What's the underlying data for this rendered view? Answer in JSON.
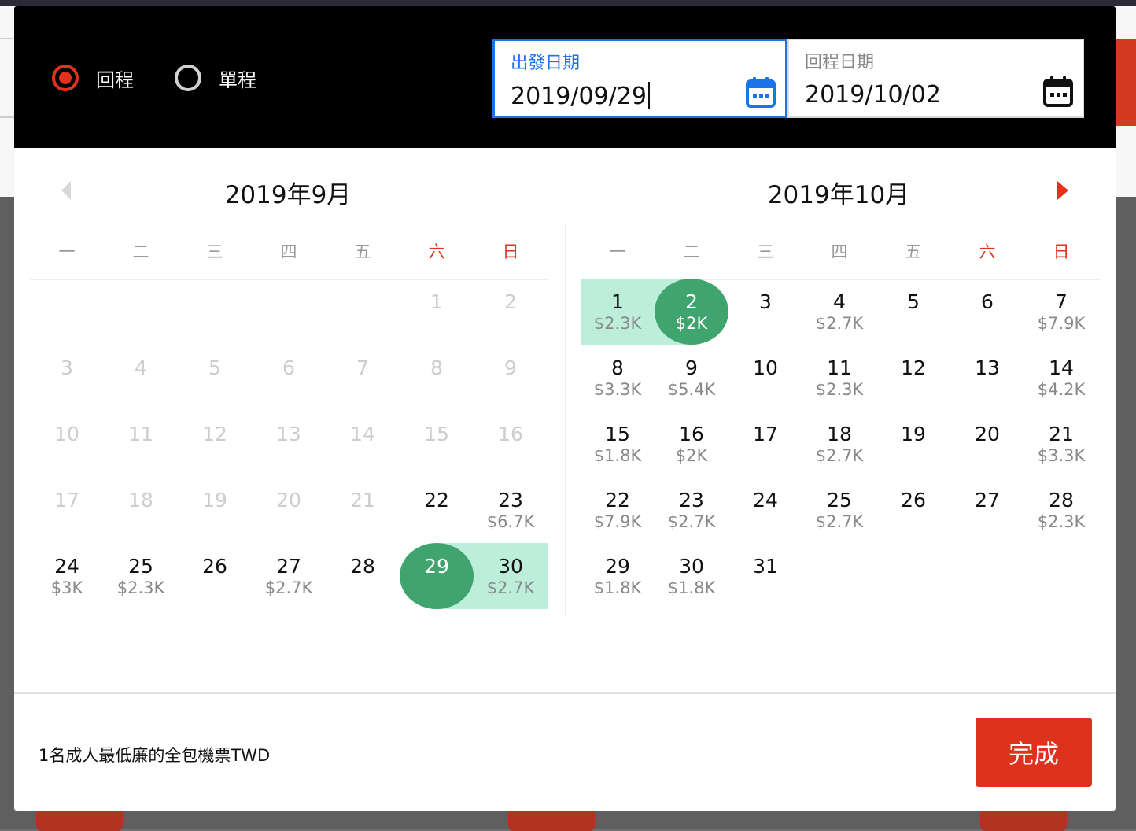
{
  "trip_type": {
    "options": [
      {
        "label": "回程",
        "checked": true
      },
      {
        "label": "單程",
        "checked": false
      }
    ]
  },
  "departure": {
    "label": "出發日期",
    "value": "2019/09/29",
    "icon": "calendar-icon",
    "active": true
  },
  "return": {
    "label": "回程日期",
    "value": "2019/10/02",
    "icon": "calendar-icon",
    "active": false
  },
  "colors": {
    "accent": "#e0321d",
    "focus": "#1a73e8",
    "selected": "#3fa46e",
    "range": "#bdeedb"
  },
  "weekdays": [
    "一",
    "二",
    "三",
    "四",
    "五",
    "六",
    "日"
  ],
  "months": [
    {
      "title": "2019年9月",
      "first_weekday": 6,
      "days": [
        {
          "d": "1",
          "p": "",
          "dis": true
        },
        {
          "d": "2",
          "p": "",
          "dis": true
        },
        {
          "d": "3",
          "p": "",
          "dis": true
        },
        {
          "d": "4",
          "p": "",
          "dis": true
        },
        {
          "d": "5",
          "p": "",
          "dis": true
        },
        {
          "d": "6",
          "p": "",
          "dis": true
        },
        {
          "d": "7",
          "p": "",
          "dis": true
        },
        {
          "d": "8",
          "p": "",
          "dis": true
        },
        {
          "d": "9",
          "p": "",
          "dis": true
        },
        {
          "d": "10",
          "p": "",
          "dis": true
        },
        {
          "d": "11",
          "p": "",
          "dis": true
        },
        {
          "d": "12",
          "p": "",
          "dis": true
        },
        {
          "d": "13",
          "p": "",
          "dis": true
        },
        {
          "d": "14",
          "p": "",
          "dis": true
        },
        {
          "d": "15",
          "p": "",
          "dis": true
        },
        {
          "d": "16",
          "p": "",
          "dis": true
        },
        {
          "d": "17",
          "p": "",
          "dis": true
        },
        {
          "d": "18",
          "p": "",
          "dis": true
        },
        {
          "d": "19",
          "p": "",
          "dis": true
        },
        {
          "d": "20",
          "p": "",
          "dis": true
        },
        {
          "d": "21",
          "p": "",
          "dis": true
        },
        {
          "d": "22",
          "p": ""
        },
        {
          "d": "23",
          "p": "$6.7K"
        },
        {
          "d": "24",
          "p": "$3K"
        },
        {
          "d": "25",
          "p": "$2.3K"
        },
        {
          "d": "26",
          "p": ""
        },
        {
          "d": "27",
          "p": "$2.7K"
        },
        {
          "d": "28",
          "p": ""
        },
        {
          "d": "29",
          "p": "",
          "sel": "start"
        },
        {
          "d": "30",
          "p": "$2.7K",
          "range": true
        }
      ]
    },
    {
      "title": "2019年10月",
      "first_weekday": 1,
      "days": [
        {
          "d": "1",
          "p": "$2.3K",
          "range": true
        },
        {
          "d": "2",
          "p": "$2K",
          "sel": "end"
        },
        {
          "d": "3",
          "p": ""
        },
        {
          "d": "4",
          "p": "$2.7K"
        },
        {
          "d": "5",
          "p": ""
        },
        {
          "d": "6",
          "p": ""
        },
        {
          "d": "7",
          "p": "$7.9K"
        },
        {
          "d": "8",
          "p": "$3.3K"
        },
        {
          "d": "9",
          "p": "$5.4K"
        },
        {
          "d": "10",
          "p": ""
        },
        {
          "d": "11",
          "p": "$2.3K"
        },
        {
          "d": "12",
          "p": ""
        },
        {
          "d": "13",
          "p": ""
        },
        {
          "d": "14",
          "p": "$4.2K"
        },
        {
          "d": "15",
          "p": "$1.8K"
        },
        {
          "d": "16",
          "p": "$2K"
        },
        {
          "d": "17",
          "p": ""
        },
        {
          "d": "18",
          "p": "$2.7K"
        },
        {
          "d": "19",
          "p": ""
        },
        {
          "d": "20",
          "p": ""
        },
        {
          "d": "21",
          "p": "$3.3K"
        },
        {
          "d": "22",
          "p": "$7.9K"
        },
        {
          "d": "23",
          "p": "$2.7K"
        },
        {
          "d": "24",
          "p": ""
        },
        {
          "d": "25",
          "p": "$2.7K"
        },
        {
          "d": "26",
          "p": ""
        },
        {
          "d": "27",
          "p": ""
        },
        {
          "d": "28",
          "p": "$2.3K"
        },
        {
          "d": "29",
          "p": "$1.8K"
        },
        {
          "d": "30",
          "p": "$1.8K"
        },
        {
          "d": "31",
          "p": ""
        }
      ]
    }
  ],
  "footer": {
    "note": "1名成人最低廉的全包機票TWD",
    "done_label": "完成"
  }
}
